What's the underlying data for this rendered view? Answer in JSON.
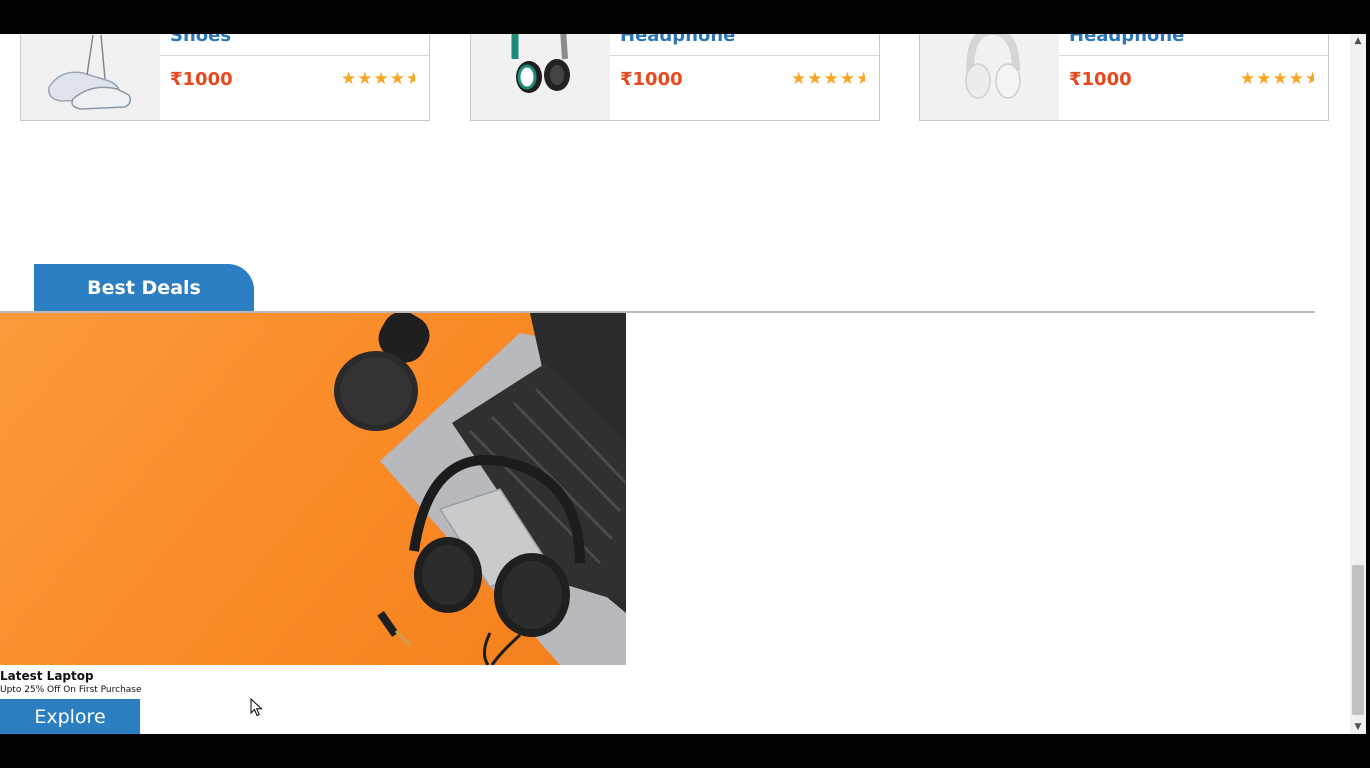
{
  "products": [
    {
      "name": "Shoes",
      "price": "₹1000",
      "stars": "★★★★",
      "half_star": "★",
      "image_icon": "sneakers-image"
    },
    {
      "name": "Headphone",
      "price": "₹1000",
      "stars": "★★★★",
      "half_star": "★",
      "image_icon": "headphone-image"
    },
    {
      "name": "Headphone",
      "price": "₹1000",
      "stars": "★★★★",
      "half_star": "★",
      "image_icon": "white-headphone-image"
    }
  ],
  "deals": {
    "tab_label": "Best Deals",
    "banner": {
      "title": "Latest Laptop",
      "subtitle": "Upto 25% Off On First Purchase",
      "button_label": "Explore",
      "background_color": "#f98a26",
      "image_icon": "laptop-headphones-microphone-image"
    }
  },
  "colors": {
    "accent": "#2a7ec1",
    "price": "#e8481b",
    "star": "#f5a623",
    "link": "#2b76b9"
  },
  "scrollbar": {
    "up_arrow": "▲",
    "down_arrow": "▼"
  }
}
